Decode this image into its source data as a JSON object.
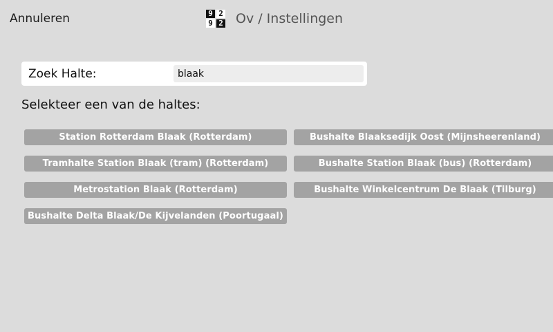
{
  "header": {
    "cancel_label": "Annuleren",
    "title": "Ov / Instellingen",
    "icon_digits": [
      "9",
      "2",
      "9",
      "2"
    ]
  },
  "search": {
    "label": "Zoek Halte:",
    "value": "blaak"
  },
  "results": {
    "heading": "Selekteer een van de haltes:",
    "items": [
      "Station Rotterdam Blaak (Rotterdam)",
      "Bushalte Blaaksedijk Oost (Mijnsheerenland)",
      "Tramhalte Station Blaak (tram) (Rotterdam)",
      "Bushalte Station Blaak (bus) (Rotterdam)",
      "Metrostation Blaak (Rotterdam)",
      "Bushalte Winkelcentrum De Blaak (Tilburg)",
      "Bushalte Delta Blaak/De Kijvelanden (Poortugaal)"
    ]
  },
  "colors": {
    "background": "#dcdcdc",
    "button": "#a3a3a3",
    "button_text": "#ffffff"
  }
}
